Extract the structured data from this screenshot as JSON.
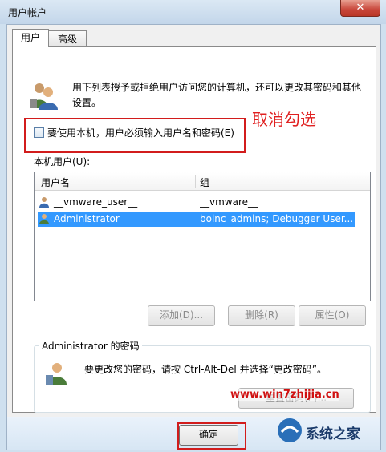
{
  "window": {
    "title": "用户帐户",
    "close_symbol": "✕"
  },
  "tabs": [
    {
      "label": "用户"
    },
    {
      "label": "高级"
    }
  ],
  "description": "用下列表授予或拒绝用户访问您的计算机，还可以更改其密码和其他设置。",
  "require_login_checkbox": {
    "label": "要使用本机，用户必须输入用户名和密码(E)",
    "checked": false
  },
  "annotation": "取消勾选",
  "local_users": {
    "label": "本机用户(U):",
    "columns": [
      "用户名",
      "组"
    ],
    "rows": [
      {
        "name": "__vmware_user__",
        "group": "__vmware__",
        "selected": false
      },
      {
        "name": "Administrator",
        "group": "boinc_admins; Debugger User...",
        "selected": true
      }
    ]
  },
  "buttons": {
    "add": "添加(D)...",
    "remove": "删除(R)",
    "properties": "属性(O)"
  },
  "password_group": {
    "title": "Administrator 的密码",
    "text": "要更改您的密码，请按 Ctrl-Alt-Del 并选择“更改密码”。",
    "reset_button": "重置密码(P)..."
  },
  "footer": {
    "ok": "确定"
  },
  "watermark": "www.win7zhijia.cn",
  "logo": "系统之家",
  "colors": {
    "selection": "#3399ff",
    "highlight_box": "#d21c1c",
    "annotation": "#e02020"
  }
}
